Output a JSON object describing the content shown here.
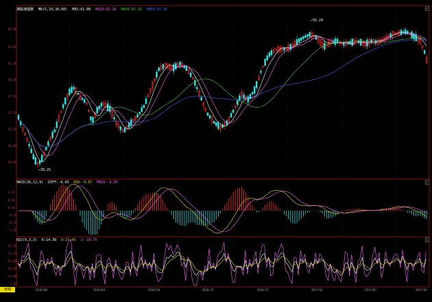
{
  "main": {
    "title": "港股通指数",
    "ma_labels": [
      {
        "text": "MA(5,10,30,60)",
        "color": "#ffffff"
      },
      {
        "text": "MA5:61.80",
        "color": "#ffffff"
      },
      {
        "text": "MA10:62.16",
        "color": "#ff60ff"
      },
      {
        "text": "MA30:63.13",
        "color": "#40d040"
      },
      {
        "text": "MA60:63.38",
        "color": "#4060ff"
      }
    ],
    "y_ticks": [
      "64.89",
      "63.03",
      "61.16",
      "59.30",
      "57.43",
      "55.57",
      "53.70",
      "51.84",
      "49.97"
    ],
    "high_annot": "←55.24",
    "low_annot": "←39.25",
    "corner_btn": "+"
  },
  "macd": {
    "labels": [
      {
        "text": "MACD(26,12,9)",
        "color": "#ffffff"
      },
      {
        "text": "DIFF:-0.43",
        "color": "#ffffff"
      },
      {
        "text": "DEA:-0.07",
        "color": "#e8d800"
      },
      {
        "text": "MACD:-0.60",
        "color": "#ff60ff"
      }
    ],
    "y_ticks": [
      "1.35",
      "0.83",
      "0.31",
      "-0.21",
      "-0.73",
      "-1.25"
    ],
    "corner_btn": "+"
  },
  "kdj": {
    "labels": [
      {
        "text": "KDJ(9,3,3)",
        "color": "#ffffff"
      },
      {
        "text": "K:14.30",
        "color": "#ffffff"
      },
      {
        "text": "D:27.43",
        "color": "#e8d800"
      },
      {
        "text": "J:-10.75",
        "color": "#ff60ff"
      }
    ],
    "y_ticks": [
      "95.22",
      "75.13",
      "55.04",
      "34.95",
      "14.86",
      "-5.23"
    ],
    "corner_btn": "+"
  },
  "x_labels": [
    "2016/08",
    "2016/09",
    "2016/10",
    "2016/11",
    "2016/12",
    "2017/01",
    "2017/02",
    "2017/03"
  ],
  "footer_tab": "日线",
  "colors": {
    "up": "#ff3030",
    "down": "#30e0e0",
    "ma5": "#ffffff",
    "ma10": "#ff60ff",
    "ma30": "#40d040",
    "ma60": "#4060ff",
    "grid": "#8a1010"
  }
}
